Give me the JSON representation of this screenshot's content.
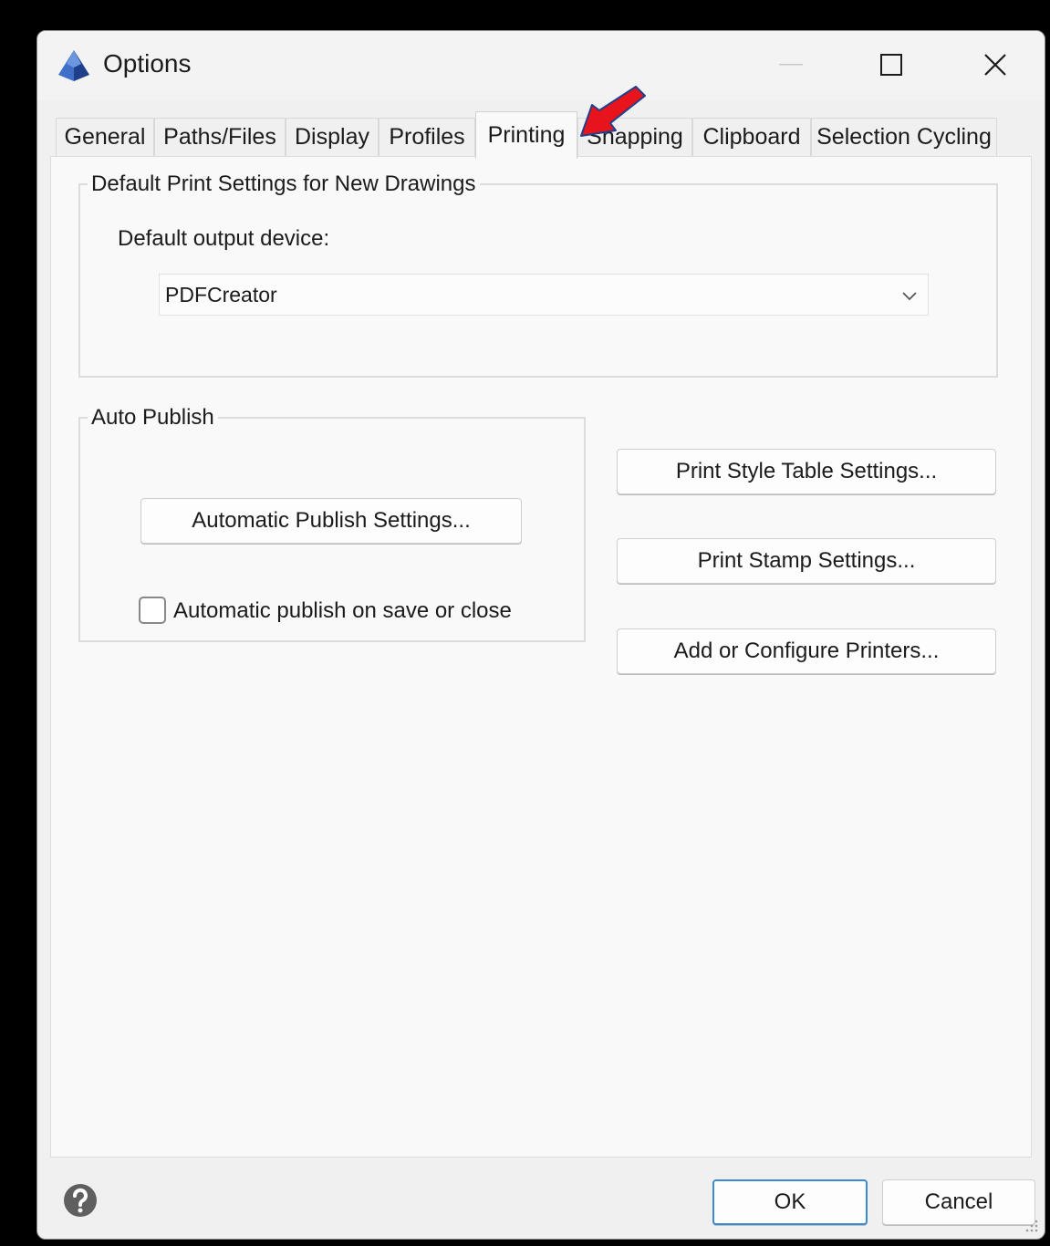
{
  "window": {
    "title": "Options",
    "icon": "app-pyramid-icon",
    "controls": {
      "minimize": "minimize-icon",
      "maximize": "maximize-icon",
      "close": "close-icon"
    }
  },
  "tabs": [
    {
      "label": "General",
      "active": false
    },
    {
      "label": "Paths/Files",
      "active": false
    },
    {
      "label": "Display",
      "active": false
    },
    {
      "label": "Profiles",
      "active": false
    },
    {
      "label": "Printing",
      "active": true
    },
    {
      "label": "Snapping",
      "active": false
    },
    {
      "label": "Clipboard",
      "active": false
    },
    {
      "label": "Selection Cycling",
      "active": false
    }
  ],
  "default_print_settings": {
    "group_title": "Default Print Settings for New Drawings",
    "device_label": "Default output device:",
    "device_value": "PDFCreator"
  },
  "auto_publish": {
    "group_title": "Auto Publish",
    "settings_button": "Automatic Publish Settings...",
    "checkbox_label": "Automatic publish on save or close",
    "checkbox_checked": false
  },
  "buttons": {
    "print_style_table": "Print Style Table Settings...",
    "print_stamp": "Print Stamp Settings...",
    "add_configure_printers": "Add or Configure Printers...",
    "ok": "OK",
    "cancel": "Cancel"
  },
  "annotation": {
    "arrow_color": "#e8141c",
    "arrow_outline": "#1f3f8f"
  },
  "accent_color": "#3c8ad6"
}
